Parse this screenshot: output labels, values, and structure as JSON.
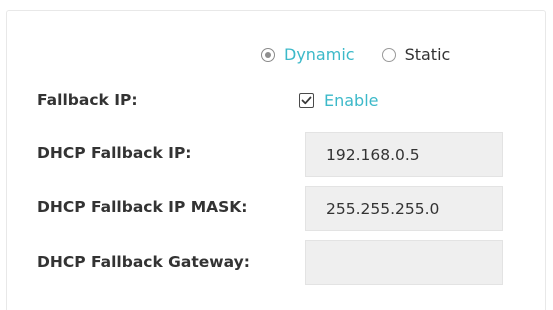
{
  "mode": {
    "options": [
      {
        "label": "Dynamic",
        "selected": true
      },
      {
        "label": "Static",
        "selected": false
      }
    ]
  },
  "fallback_ip": {
    "label": "Fallback IP:",
    "checkbox_label": "Enable",
    "checked": true
  },
  "dhcp_fallback_ip": {
    "label": "DHCP Fallback IP:",
    "value": "192.168.0.5"
  },
  "dhcp_fallback_mask": {
    "label": "DHCP Fallback IP MASK:",
    "value": "255.255.255.0"
  },
  "dhcp_fallback_gateway": {
    "label": "DHCP Fallback Gateway:",
    "value": ""
  },
  "colors": {
    "accent": "#3cb9c9",
    "text": "#333333",
    "field_bg": "#efefef"
  }
}
